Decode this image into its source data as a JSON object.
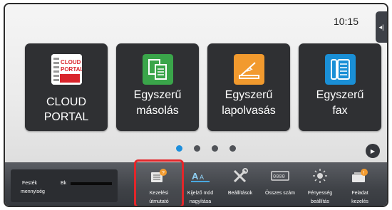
{
  "status_bar": {
    "time": "10:15"
  },
  "tiles": [
    {
      "label_line1": "CLOUD PORTAL",
      "label_line2": "",
      "logo_text_1": "CLOUD",
      "logo_text_2": "PORTAL",
      "icon": "cloud-portal-icon",
      "color": "#ffffff"
    },
    {
      "label_line1": "Egyszerű",
      "label_line2": "másolás",
      "icon": "copy-icon",
      "color": "#3aa54a"
    },
    {
      "label_line1": "Egyszerű",
      "label_line2": "lapolvasás",
      "icon": "scan-icon",
      "color": "#f29a2e"
    },
    {
      "label_line1": "Egyszerű",
      "label_line2": "fax",
      "icon": "fax-icon",
      "color": "#1a8fd6"
    }
  ],
  "pagination": {
    "page_count": 4,
    "active_index": 0
  },
  "bottom_bar": {
    "toner": {
      "label_line1": "Festék",
      "label_line2": "mennyiség",
      "color_label": "Bk",
      "level": 1.0
    },
    "buttons": [
      {
        "label_line1": "Kezelési",
        "label_line2": "útmutató",
        "icon": "manual-icon"
      },
      {
        "label_line1": "Kijelző mód",
        "label_line2": "nagyítása",
        "icon": "display-zoom-icon"
      },
      {
        "label_line1": "Beállítások",
        "label_line2": "",
        "icon": "settings-icon"
      },
      {
        "label_line1": "Összes szám",
        "label_line2": "",
        "icon": "counter-icon"
      },
      {
        "label_line1": "Fényesség",
        "label_line2": "beállítás",
        "icon": "brightness-icon"
      },
      {
        "label_line1": "Feladat",
        "label_line2": "kezelés",
        "icon": "job-status-icon"
      }
    ]
  }
}
